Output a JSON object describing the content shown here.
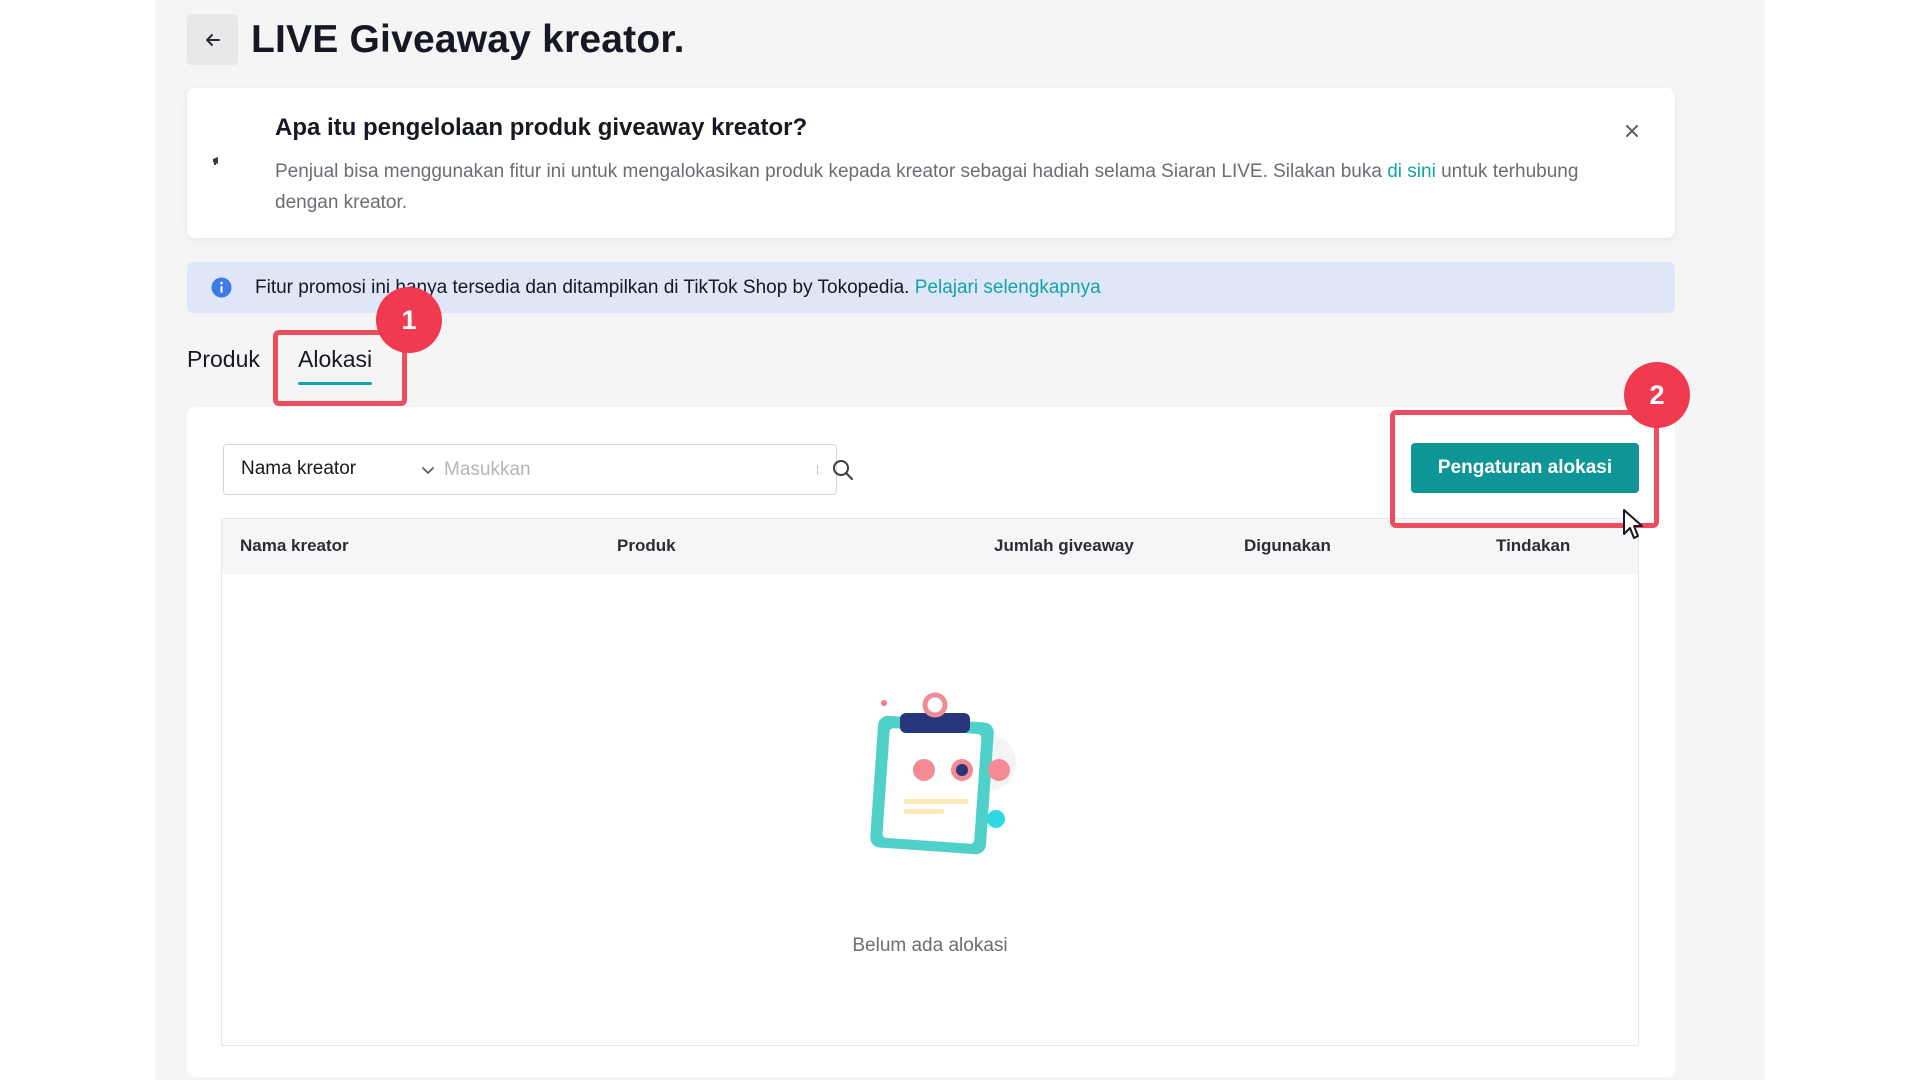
{
  "header": {
    "title": "LIVE Giveaway kreator."
  },
  "info_card": {
    "title": "Apa itu pengelolaan produk giveaway kreator?",
    "desc_before_link": "Penjual bisa menggunakan fitur ini untuk mengalokasikan produk kepada kreator sebagai hadiah selama Siaran LIVE. Silakan buka ",
    "desc_link": "di sini",
    "desc_after_link": " untuk terhubung dengan kreator."
  },
  "notice": {
    "text": "Fitur promosi ini hanya tersedia dan ditampilkan di TikTok Shop by Tokopedia.",
    "link": "Pelajari selengkapnya"
  },
  "tabs": [
    {
      "label": "Produk",
      "active": false
    },
    {
      "label": "Alokasi",
      "active": true
    }
  ],
  "annotations": [
    {
      "label": "1"
    },
    {
      "label": "2"
    }
  ],
  "search": {
    "select_value": "Nama kreator",
    "placeholder": "Masukkan"
  },
  "actions": {
    "primary_label": "Pengaturan alokasi"
  },
  "table": {
    "columns": [
      "Nama kreator",
      "Produk",
      "Jumlah giveaway",
      "Digunakan",
      "Tindakan"
    ],
    "empty_text": "Belum ada alokasi"
  },
  "colors": {
    "accent": "#0e9596",
    "link": "#13a3a8",
    "annotation": "#ed4d5c"
  },
  "icons": {
    "back": "arrow-left-icon",
    "megaphone": "megaphone-icon",
    "close": "close-icon",
    "info": "info-icon",
    "chevron": "chevron-down-icon",
    "search": "search-icon"
  }
}
